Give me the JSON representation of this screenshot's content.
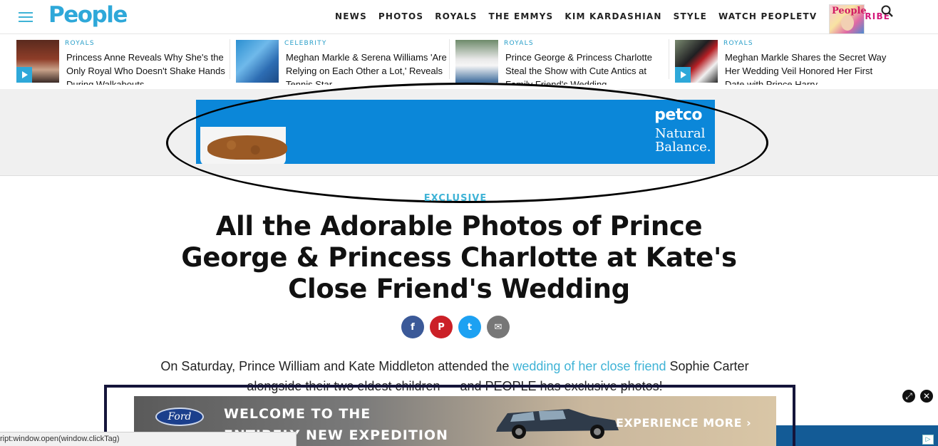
{
  "header": {
    "logo": "People",
    "nav": [
      "NEWS",
      "PHOTOS",
      "ROYALS",
      "THE EMMYS",
      "KIM KARDASHIAN",
      "STYLE",
      "WATCH PEOPLETV"
    ],
    "subscribe": "SUBSCRIBE",
    "magazine_title": "People"
  },
  "related": [
    {
      "category": "ROYALS",
      "title": "Princess Anne Reveals Why She's the Only Royal Who Doesn't Shake Hands During Walkabouts",
      "video": true
    },
    {
      "category": "CELEBRITY",
      "title": "Meghan Markle & Serena Williams 'Are Relying on Each Other a Lot,' Reveals Tennis Star",
      "video": false
    },
    {
      "category": "ROYALS",
      "title": "Prince George & Princess Charlotte Steal the Show with Cute Antics at Family Friend's Wedding",
      "video": false
    },
    {
      "category": "ROYALS",
      "title": "Meghan Markle Shares the Secret Way Her Wedding Veil Honored Her First Date with Prince Harry",
      "video": true
    }
  ],
  "ad_top": {
    "brand": "petco",
    "sub": "Natural Balance."
  },
  "article": {
    "kicker": "EXCLUSIVE",
    "headline": "All the Adorable Photos of Prince George & Princess Charlotte at Kate's Close Friend's Wedding",
    "intro_before": "On Saturday, Prince William and Kate Middleton attended the ",
    "intro_link": "wedding of her close friend",
    "intro_after": " Sophie Carter alongside their two eldest children — and PEOPLE has exclusive photos!"
  },
  "share": {
    "facebook": "f",
    "pinterest": "P",
    "twitter": "t",
    "email": "✉"
  },
  "ad_bottom": {
    "brand": "Ford",
    "line1": "WELCOME TO THE",
    "line2": "ENTIRELY NEW EXPEDITION",
    "cta": "EXPERIENCE MORE ›"
  },
  "status_bar": "ript:window.open(window.clickTag)",
  "ad_controls": {
    "expand": "⤢",
    "close": "✕"
  },
  "colors": {
    "brand": "#2ea8d9",
    "subscribe": "#d4177a",
    "petco_blue": "#0b87d9"
  }
}
